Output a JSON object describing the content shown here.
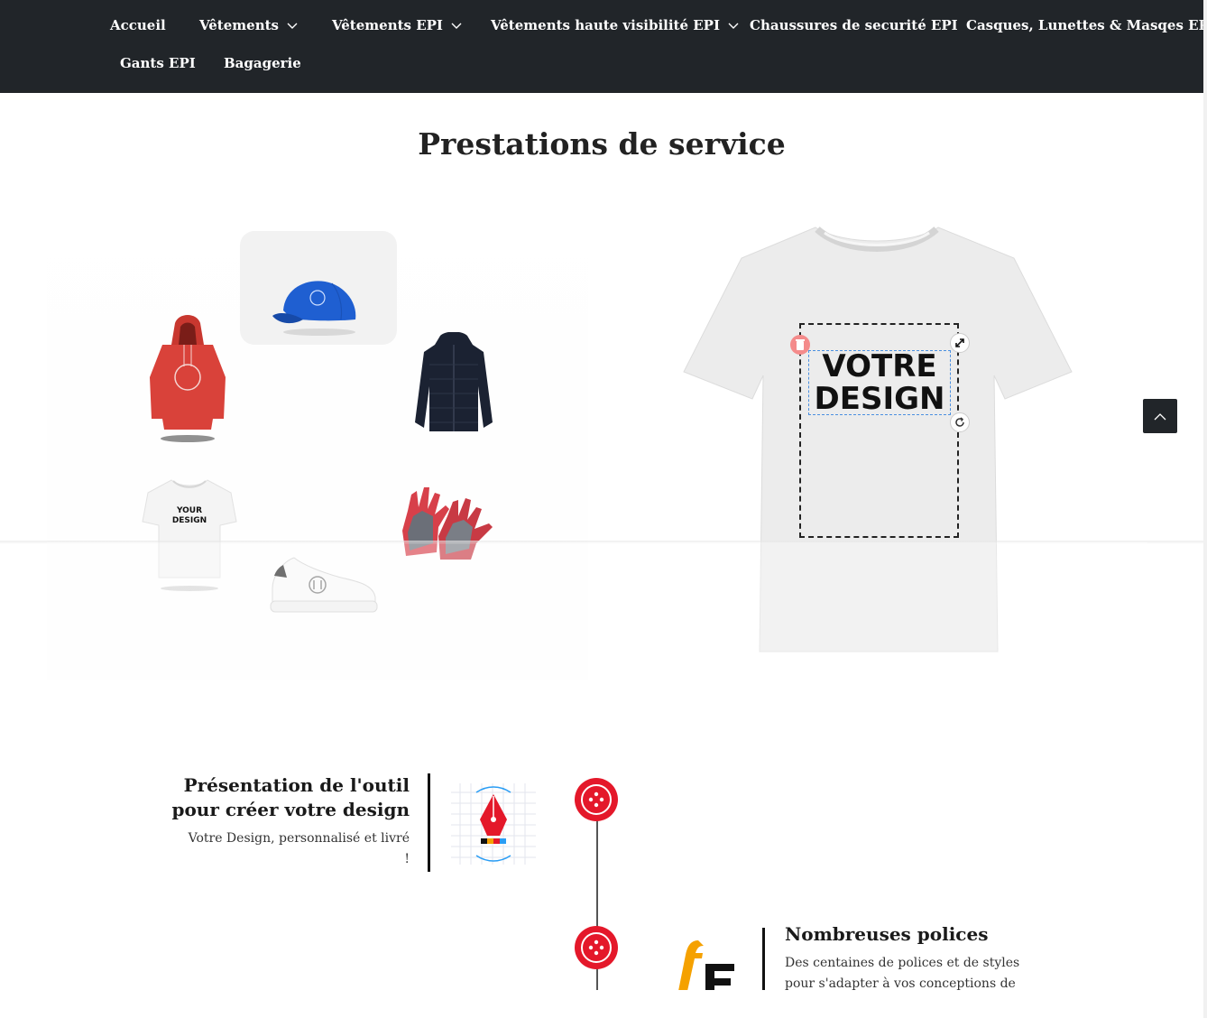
{
  "nav": {
    "items": [
      {
        "label": "Accueil",
        "has_dropdown": false
      },
      {
        "label": "Vêtements",
        "has_dropdown": true
      },
      {
        "label": "Vêtements EPI",
        "has_dropdown": true
      },
      {
        "label": "Vêtements haute visibilité EPI",
        "has_dropdown": true
      },
      {
        "label": "Chaussures de securité EPI",
        "has_dropdown": false
      },
      {
        "label": "Casques, Lunettes & Masqes EPI",
        "has_dropdown": false
      },
      {
        "label": "Gants EPI",
        "has_dropdown": false
      },
      {
        "label": "Bagagerie",
        "has_dropdown": false
      }
    ]
  },
  "services": {
    "title": "Prestations de service",
    "tshirt_small_text_1": "YOUR",
    "tshirt_small_text_2": "DESIGN",
    "design_text_line1": "VOTRE",
    "design_text_line2": "DESIGN"
  },
  "features": [
    {
      "title_line1": "Présentation de l'outil",
      "title_line2": "pour créer votre design",
      "desc_line1": "Votre Design, personnalisé et livré",
      "desc_line2": "!"
    },
    {
      "title_line1": "Nombreuses polices",
      "desc_line1": "Des centaines de polices et de styles",
      "desc_line2": "pour s'adapter à vos conceptions de"
    }
  ],
  "colors": {
    "nav_bg": "#212529",
    "accent_red": "#e4182a",
    "font_icon_orange": "#f5a100",
    "cap_blue": "#1f5fd1",
    "hoodie_red": "#d9423a"
  }
}
